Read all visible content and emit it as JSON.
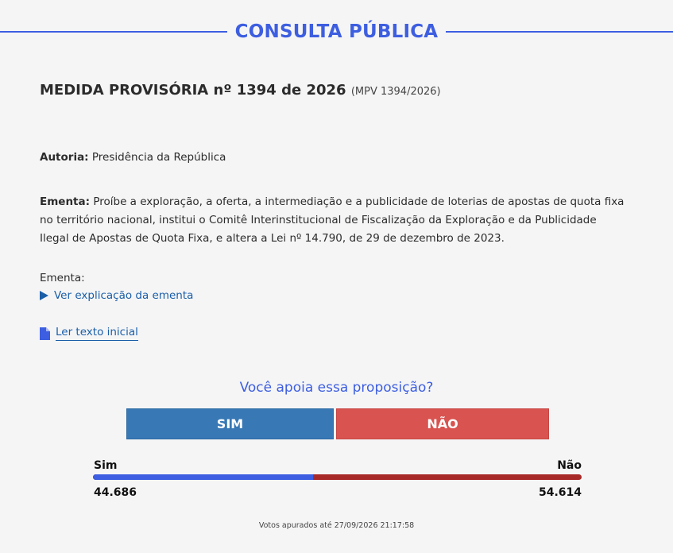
{
  "header": {
    "title": "CONSULTA PÚBLICA"
  },
  "proposal": {
    "title": "MEDIDA PROVISÓRIA nº 1394 de 2026",
    "code": "(MPV 1394/2026)",
    "autoria_label": "Autoria:",
    "autoria_value": "Presidência da República",
    "ementa_label": "Ementa:",
    "ementa_text": "Proíbe a exploração, a oferta, a intermediação e a publicidade de loterias de apostas de quota fixa no território nacional, institui o Comitê Interinstitucional de Fiscalização da Exploração e da Publicidade Ilegal de Apostas de Quota Fixa, e altera a Lei nº 14.790, de 29 de dezembro de 2023.",
    "ementa_section_label": "Ementa:",
    "explicacao_link": "Ver explicação da ementa",
    "texto_link": "Ler texto inicial"
  },
  "vote": {
    "question": "Você apoia essa proposição?",
    "sim_button": "SIM",
    "nao_button": "NÃO",
    "sim_label": "Sim",
    "nao_label": "Não",
    "sim_count": "44.686",
    "nao_count": "54.614",
    "sim_fraction": 0.45,
    "colors": {
      "sim_bar": "#3d5ee0",
      "nao_bar": "#a82a28",
      "sim_button": "#3778b5",
      "nao_button": "#d95350"
    }
  },
  "footer": {
    "note": "Votos apurados até 27/09/2026 21:17:58"
  }
}
